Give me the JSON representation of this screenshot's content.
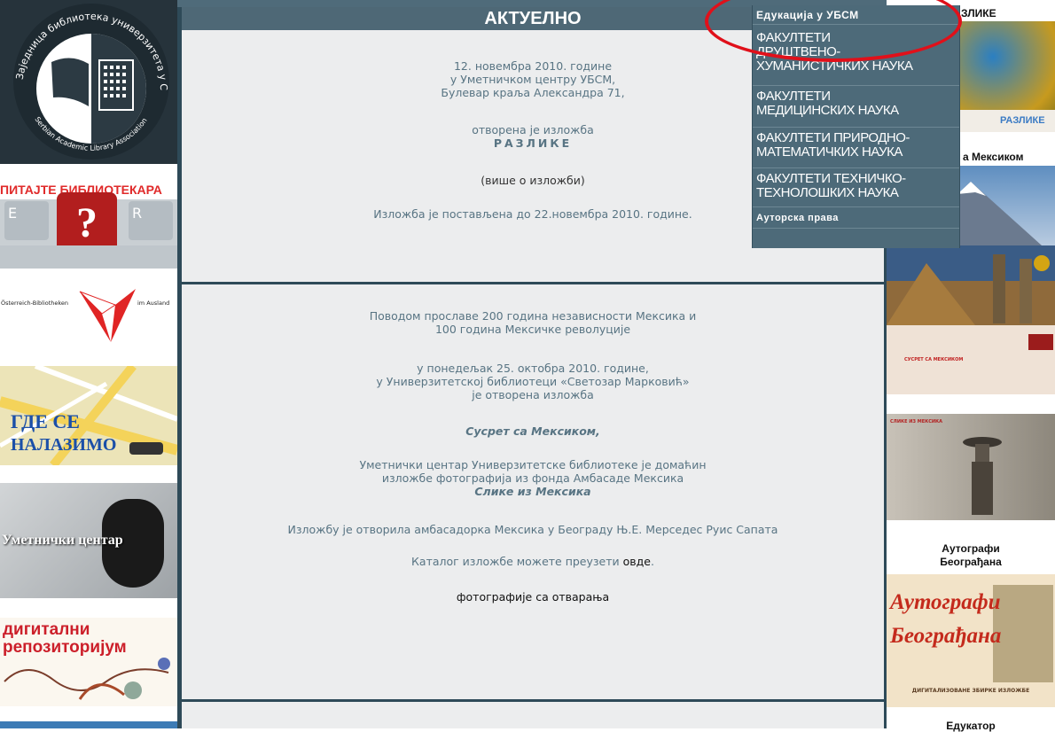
{
  "main": {
    "section_title": "АКТУЕЛНО",
    "news1": {
      "line1": "12. новембра 2010. године",
      "line2": "у Уметничком центру УБСМ,",
      "line3": "Булевар краља Александра 71,",
      "line4": "отворена је изложба",
      "title": "РАЗЛИКЕ",
      "more_link": "(више о изложби)",
      "closing": "Изложба је постављена до 22.новембра 2010. године."
    },
    "news2": {
      "p1a": "Поводом прославе 200 година независности Мексика и",
      "p1b": "100 година Мексичке револуције",
      "p2a": "у понедељак 25. октобра 2010. године,",
      "p2b": "у Универзитетској библиотеци «Светозар Марковић»",
      "p2c": "је отворена изложба",
      "title": "Сусрет са Мексиком,",
      "p3a": "Уметнички центар Универзитетске библиотеке је домаћин",
      "p3b": "изложбе фотографија из фонда Амбасаде Мексика",
      "p3c": "Слике из Мексика",
      "p4": "Изложбу је отворила амбасадорка Мексика у Београду Њ.Е. Мерседес Руис Сапата",
      "p5_text": "Каталог изложбе можете преузети ",
      "p5_link": "овде",
      "p5_end": ".",
      "photos_link": "фотографије са отварања"
    }
  },
  "left_sidebar": {
    "logo_top_arc": "Заједница библиотека универзитета у Србији",
    "logo_bottom_arc": "Serbian Academic Library Association",
    "ask_banner": "ПИТАЈТЕ БИБЛИОТЕКАРА",
    "ask_keys": [
      "E",
      "R",
      "?"
    ],
    "austria_left": "Österreich-Bibliotheken",
    "austria_right": "im Ausland",
    "where_line1": "ГДЕ СЕ",
    "where_line2": "НАЛАЗИМО",
    "art_center": "Уметнички центар",
    "digital_line1": "дигитални",
    "digital_line2": "репозиторијум"
  },
  "right_sidebar": {
    "top_label": "ЗЛИКЕ",
    "razlike_text": "РАЗЛИКЕ",
    "mexico_label": "а Мексиком",
    "catalog_text": "СУСРЕТ СА МЕКСИКОМ",
    "slike_text": "СЛИКЕ ИЗ МЕКСИКА",
    "autographs_line1": "Аутографи",
    "autographs_line2": "Београђана",
    "autographs_img_line1": "Аутографи",
    "autographs_img_line2": "Београђана",
    "autographs_caption": "ДИГИТАЛИЗОВАНЕ ЗБИРКЕ ИЗЛОЖБЕ",
    "bottom_label": "Едукатор"
  },
  "dropdown": {
    "items": [
      "Едукација у УБСМ",
      "ФАКУЛТЕТИ ДРУШТВЕНО-ХУМАНИСТИЧКИХ НАУКА",
      "ФАКУЛТЕТИ МЕДИЦИНСКИХ НАУКА",
      "ФАКУЛТЕТИ ПРИРОДНО-МАТЕМАТИЧКИХ НАУКА",
      "ФАКУЛТЕТИ ТЕХНИЧКО-ТЕХНОЛОШКИХ НАУКА",
      "Ауторска права"
    ],
    "items_display": [
      [
        "Едукација у УБСМ"
      ],
      [
        "ФАКУЛТЕТИ",
        "ДРУШТВЕНО-",
        "ХУМАНИСТИЧКИХ НАУКА"
      ],
      [
        "ФАКУЛТЕТИ",
        "МЕДИЦИНСКИХ НАУКА"
      ],
      [
        "ФАКУЛТЕТИ ПРИРОДНО-",
        "МАТЕМАТИЧКИХ НАУКА"
      ],
      [
        "ФАКУЛТЕТИ ТЕХНИЧКО-",
        "ТЕХНОЛОШКИХ НАУКА"
      ],
      [
        "Ауторска права"
      ]
    ]
  },
  "colors": {
    "header_bg": "#4e6876",
    "panel_bg": "#ecedee",
    "text": "#587483",
    "menu_bg": "#4d6a79",
    "highlight_circle": "#e0101a"
  }
}
